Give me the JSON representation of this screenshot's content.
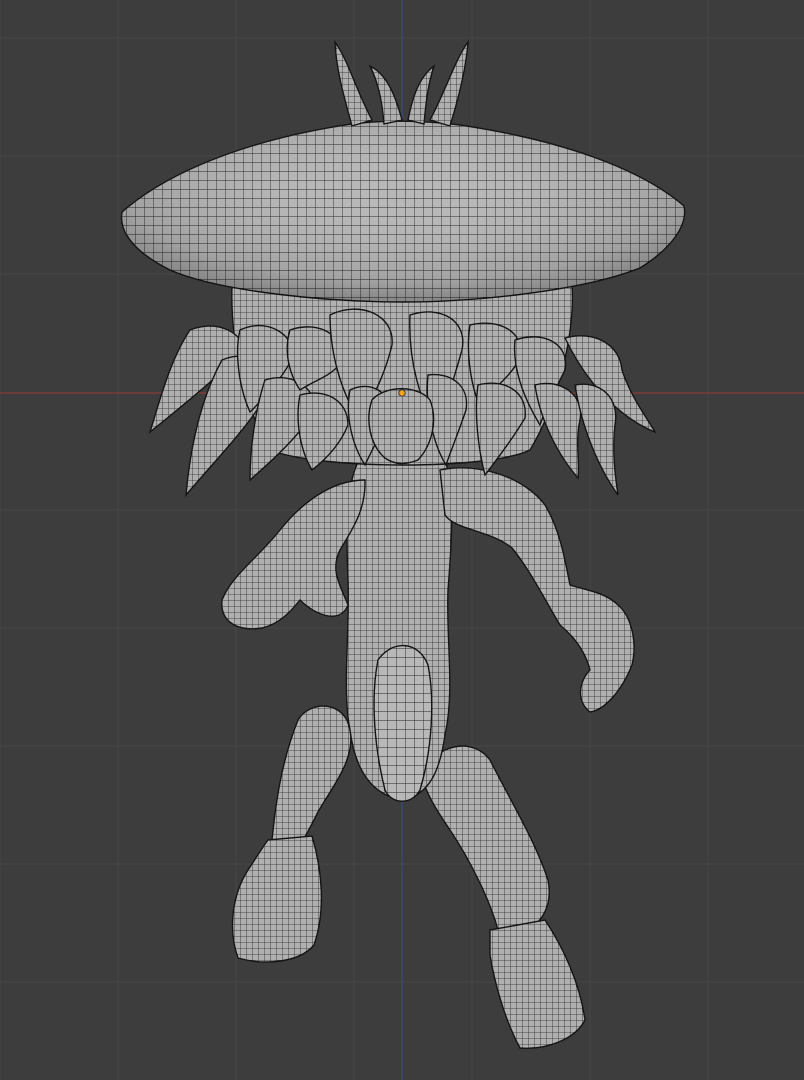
{
  "viewport": {
    "background_color": "#3d3d3d",
    "grid_color": "#474747",
    "x_axis_color": "#8a3a3a",
    "y_axis_color": "#3a4a8a",
    "origin_color": "#f2a31b",
    "grid_visible": true
  },
  "mesh": {
    "shading": "solid-wireframe",
    "surface_color": "#b5b5b5",
    "wire_color": "#1e1e1e",
    "parts": [
      "head-spikes",
      "cap",
      "tentacles",
      "torso",
      "left-arm",
      "right-arm",
      "tail",
      "left-leg",
      "right-leg",
      "left-foot",
      "right-foot"
    ]
  }
}
